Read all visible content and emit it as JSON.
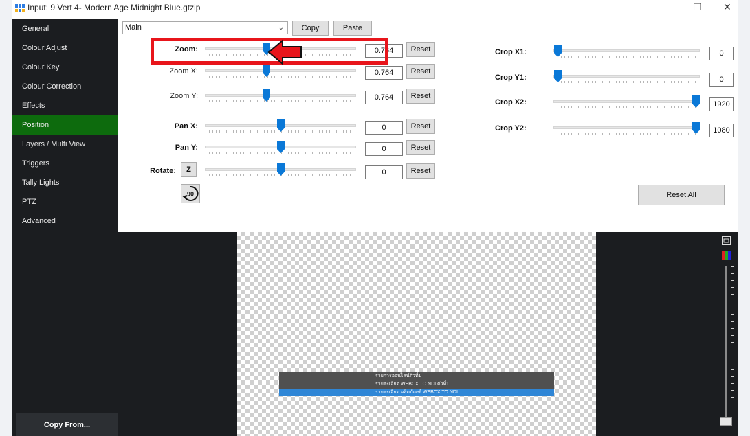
{
  "window": {
    "title": "Input: 9 Vert 4- Modern Age Midnight Blue.gtzip",
    "controls": [
      "—",
      "☐",
      "✕"
    ]
  },
  "sidebar": {
    "items": [
      {
        "label": "General",
        "active": false
      },
      {
        "label": "Colour Adjust",
        "active": false
      },
      {
        "label": "Colour Key",
        "active": false
      },
      {
        "label": "Colour Correction",
        "active": false
      },
      {
        "label": "Effects",
        "active": false
      },
      {
        "label": "Position",
        "active": true
      },
      {
        "label": "Layers / Multi View",
        "active": false
      },
      {
        "label": "Triggers",
        "active": false
      },
      {
        "label": "Tally Lights",
        "active": false
      },
      {
        "label": "PTZ",
        "active": false
      },
      {
        "label": "Advanced",
        "active": false
      }
    ],
    "copy_from": "Copy From..."
  },
  "toolbar": {
    "preset_value": "Main",
    "copy_label": "Copy",
    "paste_label": "Paste"
  },
  "position": {
    "reset_label": "Reset",
    "zoom": {
      "label": "Zoom:",
      "value": "0.764",
      "level": 0.4
    },
    "zoom_x": {
      "label": "Zoom X:",
      "value": "0.764",
      "level": 0.4
    },
    "zoom_y": {
      "label": "Zoom Y:",
      "value": "0.764",
      "level": 0.4
    },
    "pan_x": {
      "label": "Pan X:",
      "value": "0",
      "level": 0.5
    },
    "pan_y": {
      "label": "Pan Y:",
      "value": "0",
      "level": 0.5
    },
    "rotate": {
      "label": "Rotate:",
      "value": "0",
      "level": 0.5,
      "z_label": "Z",
      "rotate90_label": "90"
    }
  },
  "crop": {
    "x1": {
      "label": "Crop X1:",
      "value": "0",
      "level": 0
    },
    "y1": {
      "label": "Crop Y1:",
      "value": "0",
      "level": 0
    },
    "x2": {
      "label": "Crop X2:",
      "value": "1920",
      "level": 1
    },
    "y2": {
      "label": "Crop Y2:",
      "value": "1080",
      "level": 1
    },
    "reset_all_label": "Reset All"
  },
  "preview": {
    "lower_third": [
      "รายการออนไลน์ตัวที่1",
      "รายละเอียด WEBCX TO NDI ตัวที่1",
      "รายละเอียด ผลิตภัณฑ์ WEBCX TO NDI"
    ]
  },
  "colors": {
    "active_tab": "#0d6b0d",
    "slider_thumb": "#0a78d7",
    "highlight": "#e8151b"
  }
}
